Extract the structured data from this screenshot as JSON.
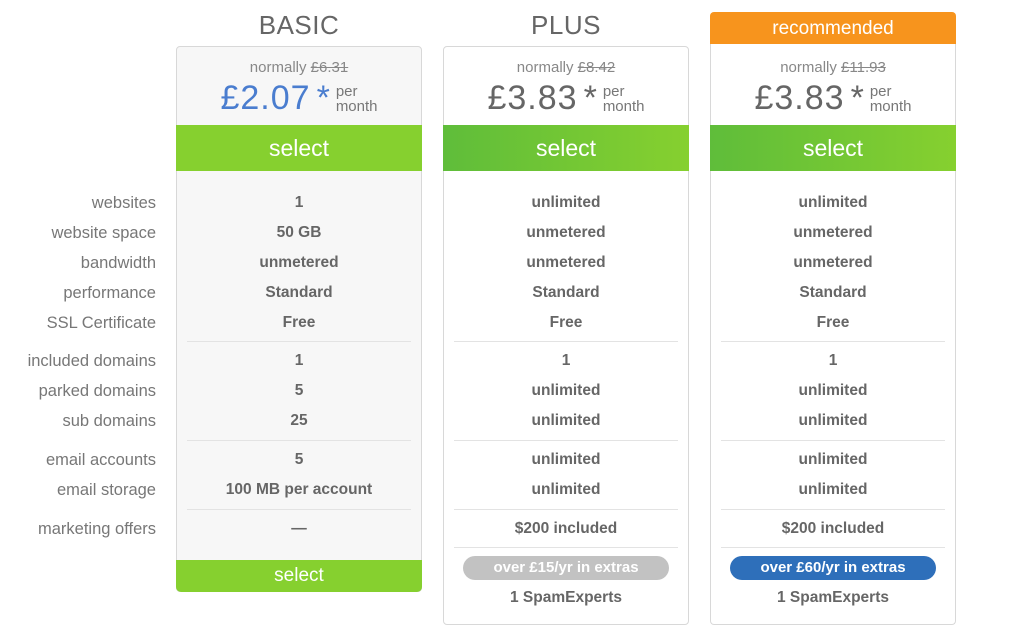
{
  "feature_labels": [
    "websites",
    "website space",
    "bandwidth",
    "performance",
    "SSL Certificate",
    "included domains",
    "parked domains",
    "sub domains",
    "email accounts",
    "email storage",
    "marketing offers"
  ],
  "plans": [
    {
      "name": "BASIC",
      "normally_label": "normally",
      "normal_price": "£6.31",
      "price": "£2.07",
      "asterisk": "*",
      "per": "per",
      "period": "month",
      "select_label": "select",
      "bottom_select_label": "select",
      "values": [
        "1",
        "50 GB",
        "unmetered",
        "Standard",
        "Free",
        "1",
        "5",
        "25",
        "5",
        "100 MB per account",
        "—"
      ]
    },
    {
      "name": "PLUS",
      "normally_label": "normally",
      "normal_price": "£8.42",
      "price": "£3.83",
      "asterisk": "*",
      "per": "per",
      "period": "month",
      "select_label": "select",
      "values": [
        "unlimited",
        "unmetered",
        "unmetered",
        "Standard",
        "Free",
        "1",
        "unlimited",
        "unlimited",
        "unlimited",
        "unlimited",
        "$200 included"
      ],
      "extras_badge": "over £15/yr in extras",
      "extra_item": "1 SpamExperts"
    },
    {
      "badge": "recommended",
      "normally_label": "normally",
      "normal_price": "£11.93",
      "price": "£3.83",
      "asterisk": "*",
      "per": "per",
      "period": "month",
      "select_label": "select",
      "values": [
        "unlimited",
        "unmetered",
        "unmetered",
        "Standard",
        "Free",
        "1",
        "unlimited",
        "unlimited",
        "unlimited",
        "unlimited",
        "$200 included"
      ],
      "extras_badge": "over £60/yr in extras",
      "extra_item": "1 SpamExperts"
    }
  ],
  "colors": {
    "select_green": "#86d02f",
    "recommended_orange": "#f7941d",
    "basic_price_blue": "#4a7dcf",
    "extras_grey": "#c2c2c2",
    "extras_blue": "#2e6fba"
  }
}
